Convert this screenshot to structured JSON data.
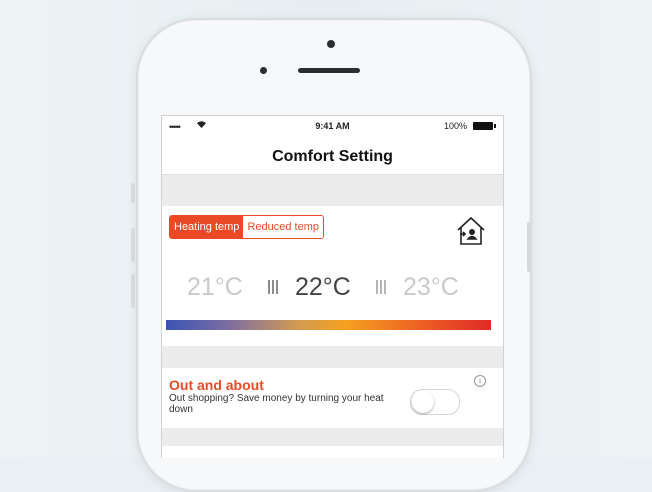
{
  "status_bar": {
    "signal": "•••••",
    "time": "9:41 AM",
    "battery_pct": "100%"
  },
  "nav": {
    "title": "Comfort Setting"
  },
  "temperature": {
    "tabs": [
      {
        "label": "Heating temp",
        "active": true
      },
      {
        "label": "Reduced temp",
        "active": false
      }
    ],
    "values": [
      "21°C",
      "22°C",
      "23°C"
    ],
    "selected": "22°C",
    "icon": "house-person-icon"
  },
  "out_and_about": {
    "title": "Out and about",
    "subtitle": "Out shopping? Save money by turning your heat down",
    "toggle_on": false,
    "info_icon": "i"
  },
  "colors": {
    "accent": "#e94a25",
    "gradient": [
      "#3b54b4",
      "#f5a11f",
      "#de2b27"
    ]
  }
}
